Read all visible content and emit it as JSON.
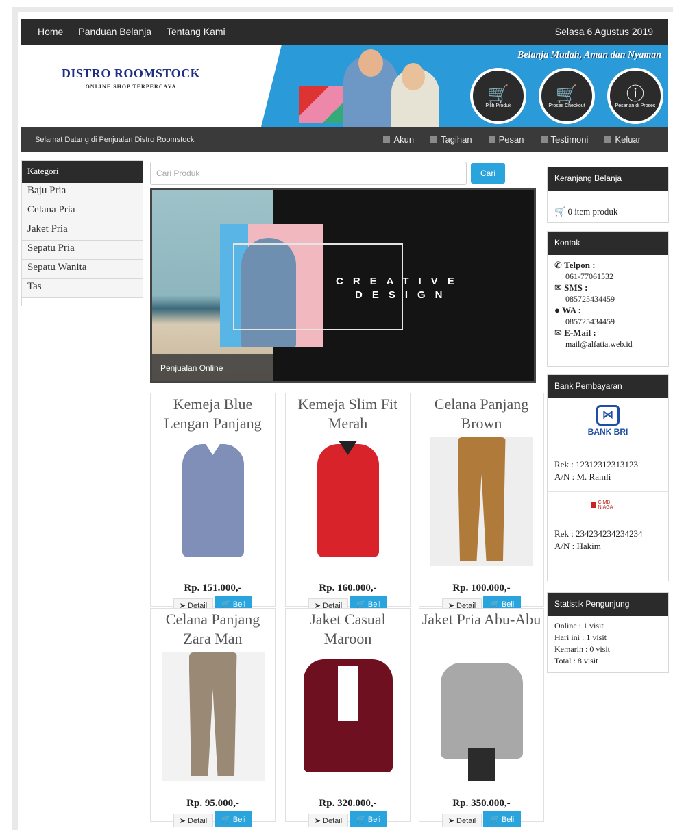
{
  "topnav": {
    "links": [
      "Home",
      "Panduan Belanja",
      "Tentang Kami"
    ],
    "date": "Selasa 6 Agustus 2019"
  },
  "header": {
    "store_name": "DISTRO ROOMSTOCK",
    "tagline": "ONLINE SHOP TERPERCAYA",
    "slogan": "Belanja Mudah, Aman dan Nyaman",
    "steps": [
      "Pilih Produk",
      "Proses Checkout",
      "Pesanan di Proses"
    ]
  },
  "subbar": {
    "welcome": "Selamat Datang di Penjualan Distro Roomstock",
    "menu": [
      "Akun",
      "Tagihan",
      "Pesan",
      "Testimoni",
      "Keluar"
    ]
  },
  "categories": {
    "title": "Kategori",
    "items": [
      "Baju Pria",
      "Celana Pria",
      "Jaket Pria",
      "Sepatu Pria",
      "Sepatu Wanita",
      "Tas"
    ]
  },
  "search": {
    "placeholder": "Cari Produk",
    "button": "Cari"
  },
  "slider": {
    "line1": "CREATIVE",
    "line2": "DESIGN",
    "caption": "Penjualan Online"
  },
  "products": [
    {
      "name": "Kemeja Blue Lengan Panjang",
      "price": "Rp. 151.000,-",
      "color": "#7f8fb8"
    },
    {
      "name": "Kemeja Slim Fit Merah",
      "price": "Rp. 160.000,-",
      "color": "#d8232a"
    },
    {
      "name": "Celana Panjang Brown",
      "price": "Rp. 100.000,-",
      "color": "#b07a3a"
    },
    {
      "name": "Celana Panjang Zara Man",
      "price": "Rp. 95.000,-",
      "color": "#9a8a75"
    },
    {
      "name": "Jaket Casual Maroon",
      "price": "Rp. 320.000,-",
      "color": "#6e1020"
    },
    {
      "name": "Jaket Pria Abu-Abu",
      "price": "Rp. 350.000,-",
      "color": "#a8a8a8"
    }
  ],
  "product_buttons": {
    "detail": "Detail",
    "buy": "Beli"
  },
  "cart": {
    "title": "Keranjang Belanja",
    "text": "0 item produk"
  },
  "contact": {
    "title": "Kontak",
    "items": [
      {
        "label": "Telpon :",
        "value": "061-77061532"
      },
      {
        "label": "SMS :",
        "value": "085725434459"
      },
      {
        "label": "WA :",
        "value": "085725434459"
      },
      {
        "label": "E-Mail :",
        "value": "mail@alfatia.web.id"
      }
    ]
  },
  "bank": {
    "title": "Bank Pembayaran",
    "bri_logo": "BANK BRI",
    "bri_account": "Rek : 12312312313123",
    "bri_name": "A/N : M. Ramli",
    "cimb_logo": "CIMB NIAGA",
    "cimb_account": "Rek : 234234234234234",
    "cimb_name": "A/N : Hakim"
  },
  "stats": {
    "title": "Statistik Pengunjung",
    "lines": [
      "Online : 1 visit",
      "Hari ini : 1 visit",
      "Kemarin : 0 visit",
      "Total : 8 visit"
    ]
  }
}
